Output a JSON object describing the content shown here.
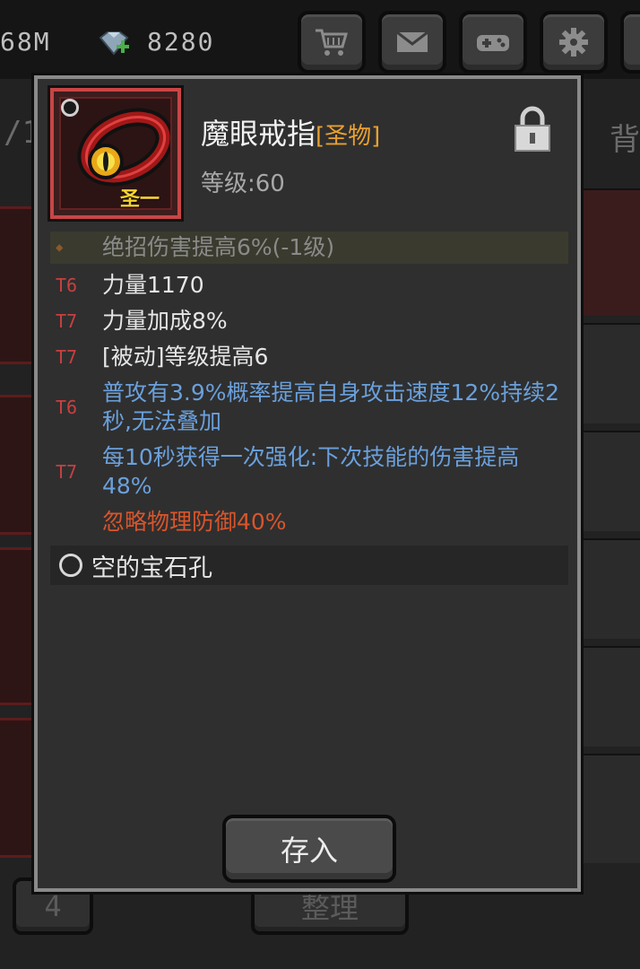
{
  "topbar": {
    "gold": "68M",
    "gems": "8280",
    "buttons": [
      {
        "icon": "cart-icon"
      },
      {
        "icon": "mail-icon"
      },
      {
        "icon": "gamepad-icon"
      },
      {
        "icon": "gear-icon"
      }
    ]
  },
  "background": {
    "tab_left": "/1",
    "tab_right": "背",
    "bottom_left_button": "4",
    "sort_button": "整理"
  },
  "item": {
    "tier_tag": "圣一",
    "name": "魔眼戒指",
    "rarity": "[圣物]",
    "level": "等级:60",
    "locked": true
  },
  "stats": [
    {
      "tier": "",
      "text": "绝招伤害提高6%(-1级)",
      "style": "dim"
    },
    {
      "tier": "T6",
      "text": "力量1170",
      "style": "white"
    },
    {
      "tier": "T7",
      "text": "力量加成8%",
      "style": "white"
    },
    {
      "tier": "T7",
      "text": "[被动]等级提高6",
      "style": "white"
    },
    {
      "tier": "T6",
      "text": "普攻有3.9%概率提高自身攻击速度12%持续2秒,无法叠加",
      "style": "blue"
    },
    {
      "tier": "T7",
      "text": "每10秒获得一次强化:下次技能的伤害提高48%",
      "style": "blue"
    },
    {
      "tier": "",
      "text": "忽略物理防御40%",
      "style": "orange"
    }
  ],
  "gem_slot": {
    "label": "空的宝石孔"
  },
  "store_button": {
    "label": "存入"
  },
  "colors": {
    "rarity": "#e8a030",
    "tier": "#c84040",
    "blue_affix": "#6aa0dc",
    "orange_affix": "#d8552c"
  }
}
